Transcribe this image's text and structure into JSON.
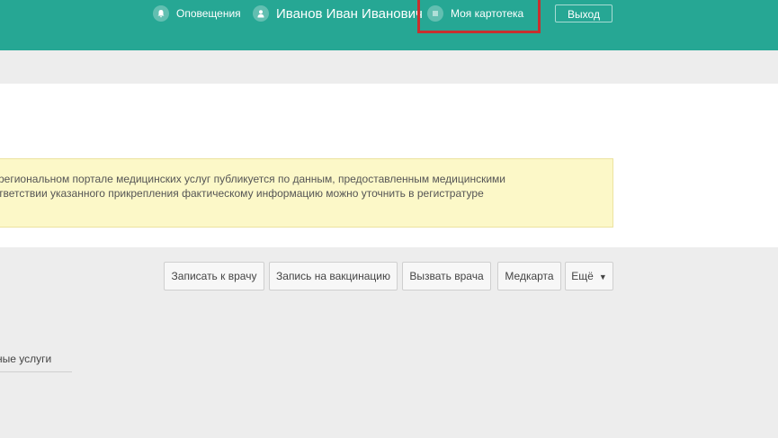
{
  "header": {
    "notifications_label": "Оповещения",
    "user_name": "Иванов Иван Иванович",
    "my_card_label": "Моя картотека",
    "logout_label": "Выход"
  },
  "notice": {
    "line1": "региональном портале медицинских услуг публикуется по данным, предоставленным медицинскими",
    "line2": "тветствии указанного прикрепления фактическому информацию можно уточнить в регистратуре"
  },
  "actions": {
    "book_doctor": "Записать к врачу",
    "book_vaccination": "Запись на вакцинацию",
    "call_doctor": "Вызвать врача",
    "medcard": "Медкарта",
    "more": "Ещё"
  },
  "sidebar": {
    "tab_label": "ные услуги"
  },
  "colors": {
    "header_bg": "#26a794",
    "highlight_border": "#c8302f",
    "notice_bg": "#fcf8c8"
  }
}
